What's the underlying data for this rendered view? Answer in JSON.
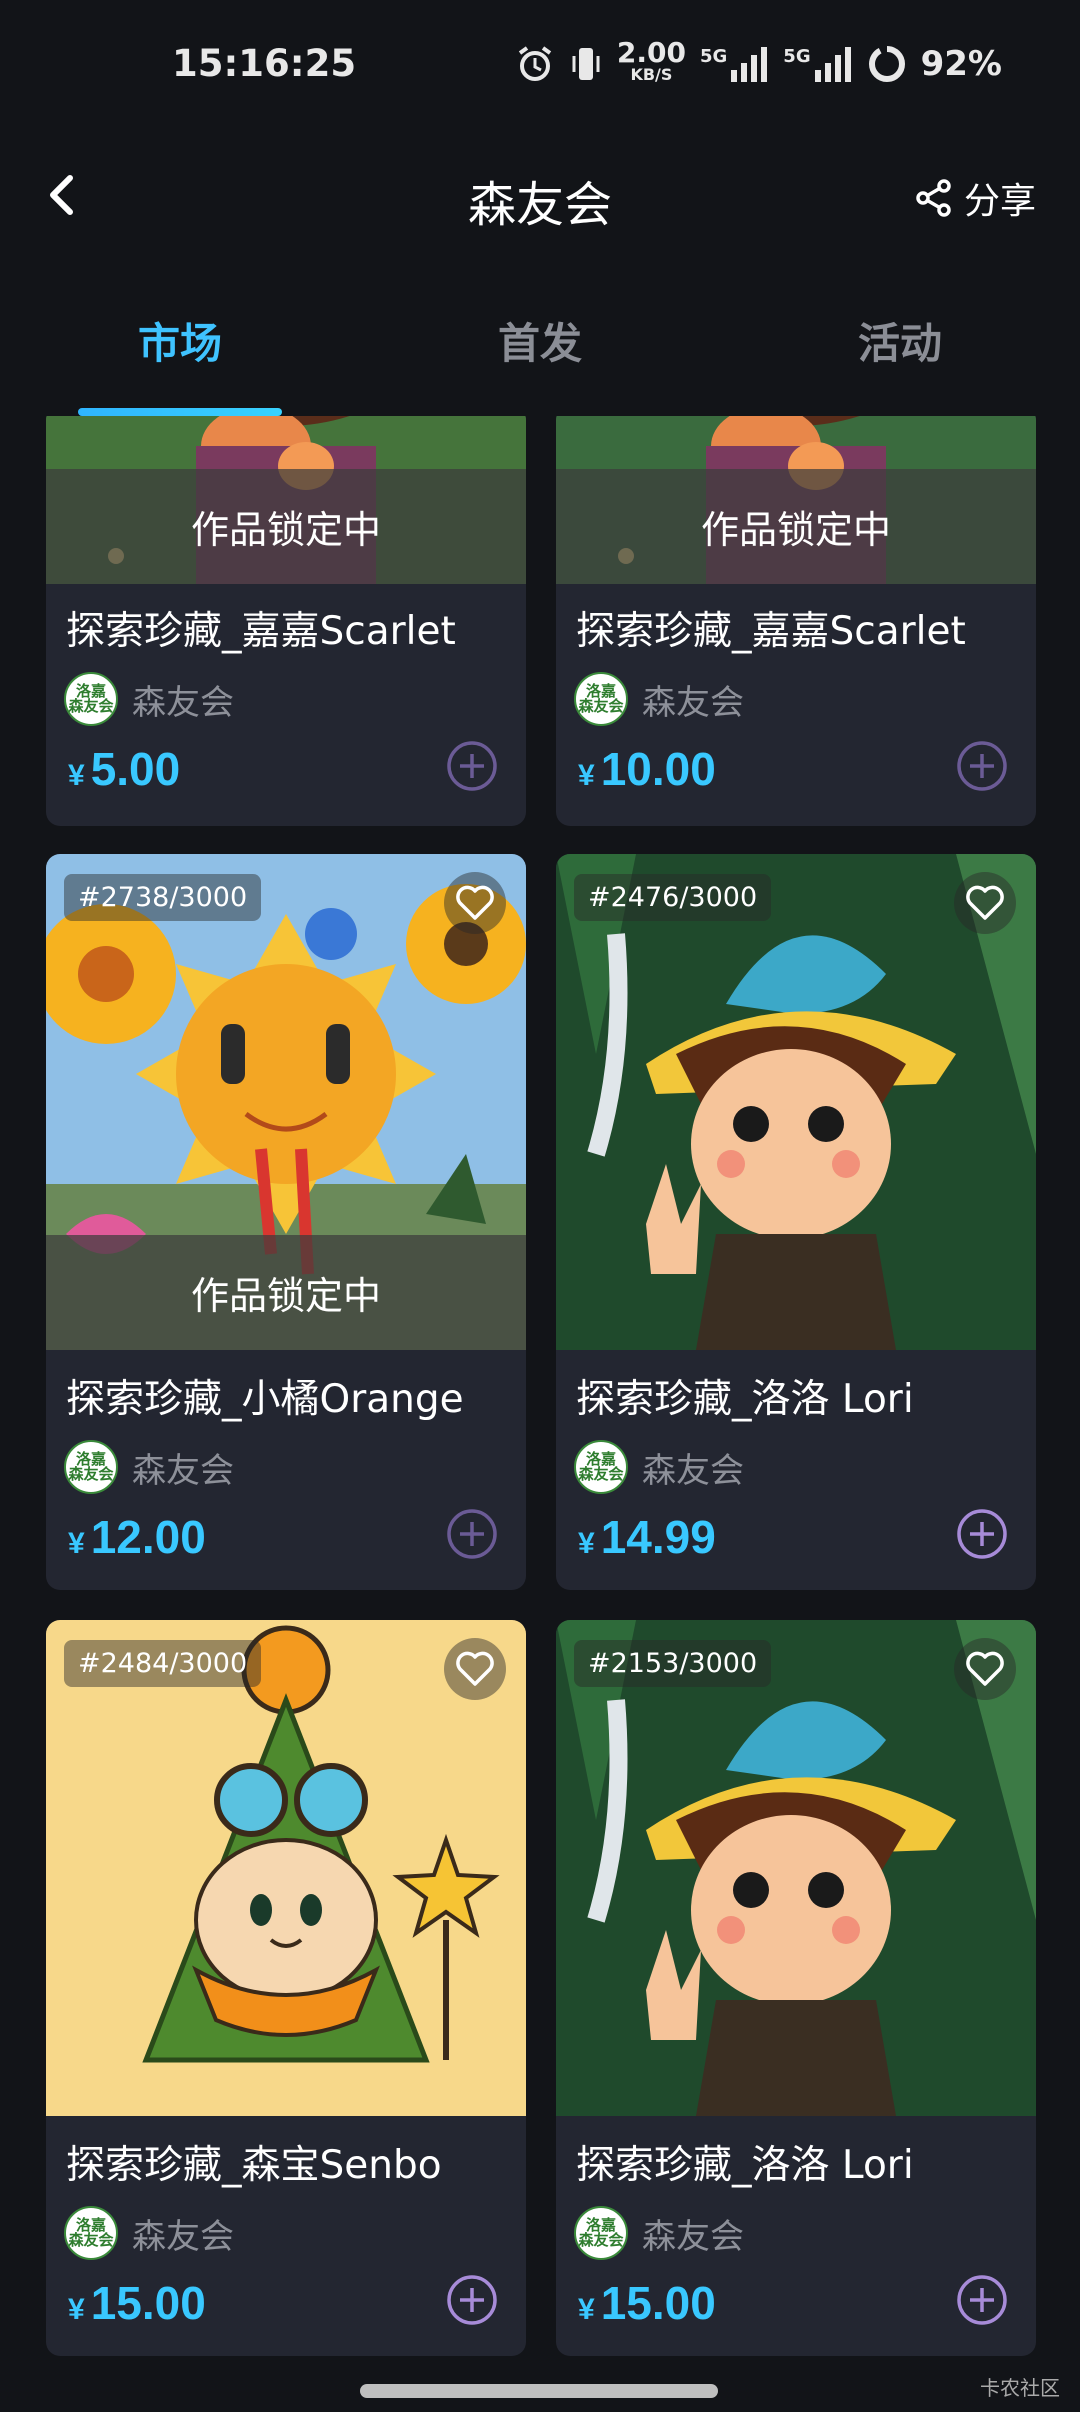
{
  "status_bar": {
    "time": "15:16:25",
    "net_speed_value": "2.00",
    "net_speed_unit": "KB/S",
    "signal1_label": "5G",
    "signal2_label": "5G",
    "battery": "92%"
  },
  "nav": {
    "title": "森友会",
    "share_label": "分享"
  },
  "tabs": [
    {
      "label": "市场",
      "active": true
    },
    {
      "label": "首发",
      "active": false
    },
    {
      "label": "活动",
      "active": false
    }
  ],
  "colors": {
    "accent": "#39c8ff",
    "background": "#121418",
    "card": "#232631"
  },
  "cards": [
    {
      "title": "探索珍藏_嘉嘉Scarlet",
      "creator": "森友会",
      "price": "5.00",
      "currency": "¥",
      "locked_label": "作品锁定中",
      "serial": "",
      "favorited": false
    },
    {
      "title": "探索珍藏_嘉嘉Scarlet",
      "creator": "森友会",
      "price": "10.00",
      "currency": "¥",
      "locked_label": "作品锁定中",
      "serial": "",
      "favorited": false
    },
    {
      "title": "探索珍藏_小橘Orange",
      "creator": "森友会",
      "price": "12.00",
      "currency": "¥",
      "locked_label": "作品锁定中",
      "serial": "#2738/3000",
      "favorited": false
    },
    {
      "title": "探索珍藏_洛洛 Lori",
      "creator": "森友会",
      "price": "14.99",
      "currency": "¥",
      "locked_label": "",
      "serial": "#2476/3000",
      "favorited": false
    },
    {
      "title": "探索珍藏_森宝Senbo",
      "creator": "森友会",
      "price": "15.00",
      "currency": "¥",
      "locked_label": "",
      "serial": "#2484/3000",
      "favorited": false
    },
    {
      "title": "探索珍藏_洛洛 Lori",
      "creator": "森友会",
      "price": "15.00",
      "currency": "¥",
      "locked_label": "",
      "serial": "#2153/3000",
      "favorited": false
    }
  ],
  "avatar_text": "洛嘉\n森友会",
  "watermark": "卡农社区"
}
